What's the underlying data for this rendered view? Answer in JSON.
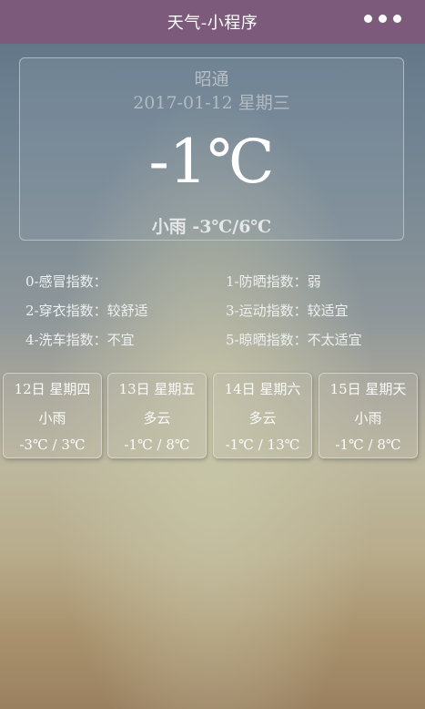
{
  "nav": {
    "title": "天气-小程序",
    "more_icon": "more-dots-icon"
  },
  "current": {
    "city": "昭通",
    "date": "2017-01-12 星期三",
    "temperature": "-1℃",
    "summary": "小雨 -3℃/6℃"
  },
  "indices": [
    {
      "text": "0-感冒指数："
    },
    {
      "text": "1-防晒指数：弱"
    },
    {
      "text": "2-穿衣指数：较舒适"
    },
    {
      "text": "3-运动指数：较适宜"
    },
    {
      "text": "4-洗车指数：不宜"
    },
    {
      "text": "5-晾晒指数：不太适宜"
    }
  ],
  "forecast": [
    {
      "day": "12日 星期四",
      "condition": "小雨",
      "range": "-3℃ / 3℃"
    },
    {
      "day": "13日 星期五",
      "condition": "多云",
      "range": "-1℃ / 8℃"
    },
    {
      "day": "14日 星期六",
      "condition": "多云",
      "range": "-1℃ / 13℃"
    },
    {
      "day": "15日 星期天",
      "condition": "小雨",
      "range": "-1℃ / 8℃"
    }
  ]
}
